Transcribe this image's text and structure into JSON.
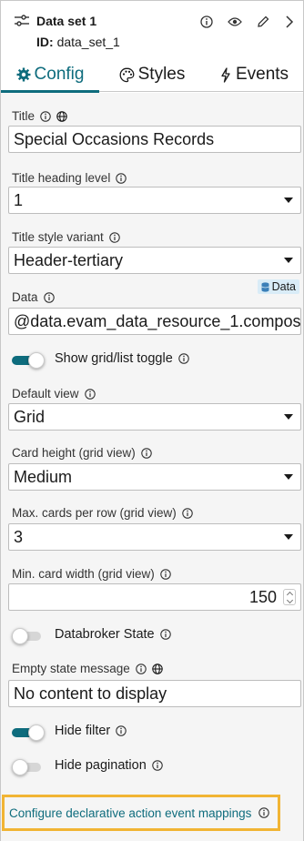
{
  "header": {
    "title": "Data set 1",
    "id_prefix": "ID:",
    "id_value": "data_set_1"
  },
  "tabs": [
    {
      "label": "Config",
      "icon": "gear-icon",
      "active": true
    },
    {
      "label": "Styles",
      "icon": "palette-icon",
      "active": false
    },
    {
      "label": "Events",
      "icon": "lightning-icon",
      "active": false
    }
  ],
  "form": {
    "title_label": "Title",
    "title_value": "Special Occasions Records",
    "heading_level_label": "Title heading level",
    "heading_level_value": "1",
    "style_variant_label": "Title style variant",
    "style_variant_value": "Header-tertiary",
    "data_label": "Data",
    "data_badge": "Data",
    "data_value": "@data.evam_data_resource_1.compos",
    "show_toggle_label": "Show grid/list toggle",
    "show_toggle_on": true,
    "default_view_label": "Default view",
    "default_view_value": "Grid",
    "card_height_label": "Card height (grid view)",
    "card_height_value": "Medium",
    "max_cards_label": "Max. cards per row (grid view)",
    "max_cards_value": "3",
    "min_width_label": "Min. card width (grid view)",
    "min_width_value": "150",
    "databroker_label": "Databroker State",
    "databroker_on": false,
    "empty_state_label": "Empty state message",
    "empty_state_value": "No content to display",
    "hide_filter_label": "Hide filter",
    "hide_filter_on": true,
    "hide_pagination_label": "Hide pagination",
    "hide_pagination_on": false,
    "configure_link": "Configure declarative action event mappings"
  },
  "colors": {
    "accent": "#0e6c7d",
    "highlight_border": "#f1b434",
    "badge_bg": "#d9ecf7"
  }
}
